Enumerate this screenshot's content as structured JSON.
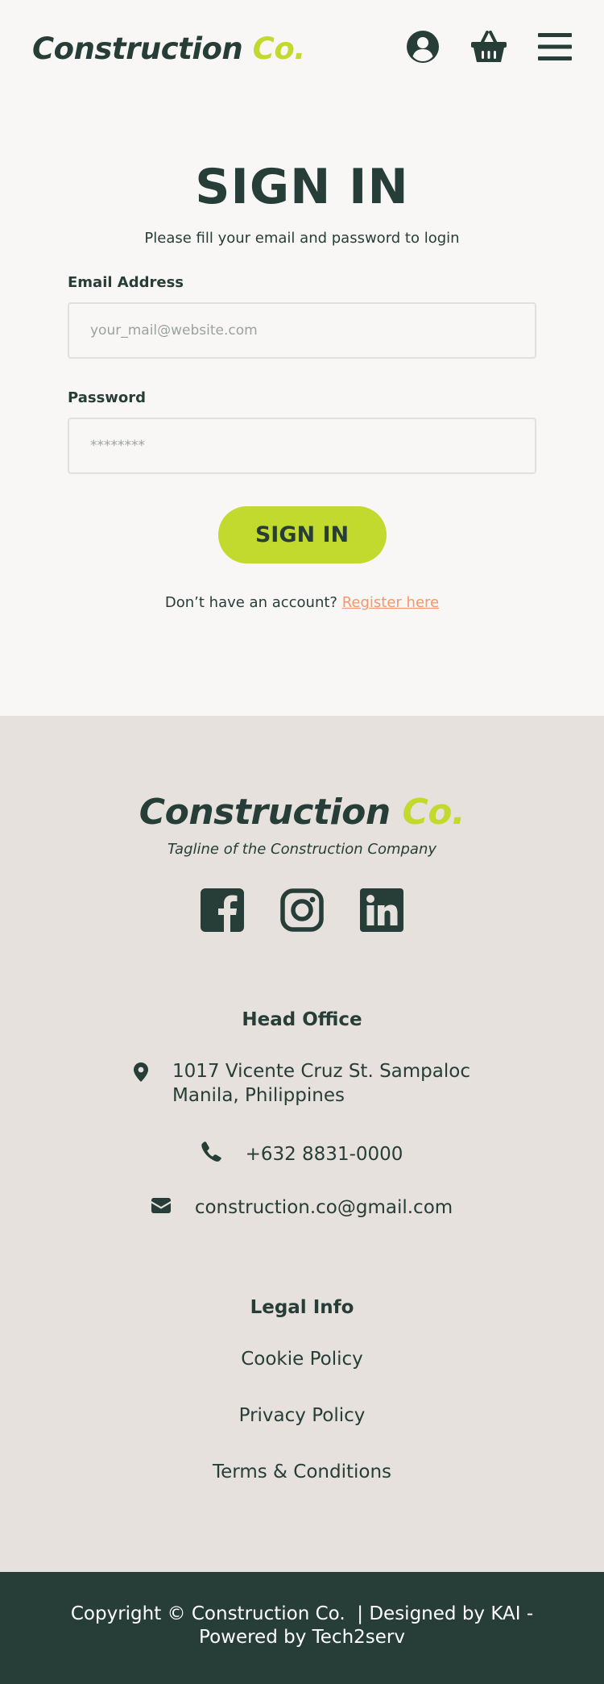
{
  "header": {
    "logo_main": "Construction",
    "logo_accent": "Co.",
    "icons": [
      "user-icon",
      "basket-icon",
      "menu-icon"
    ]
  },
  "signin": {
    "title": "SIGN IN",
    "subtitle": "Please fill your email and password to login",
    "email_label": "Email Address",
    "email_placeholder": "your_mail@website.com",
    "email_value": "",
    "password_label": "Password",
    "password_placeholder": "********",
    "password_value": "",
    "button_label": "SIGN IN",
    "register_prompt": "Don’t have an account?",
    "register_link": "Register here"
  },
  "footer": {
    "logo_main": "Construction",
    "logo_accent": "Co.",
    "tagline": "Tagline of the Construction Company",
    "social": [
      "facebook-icon",
      "instagram-icon",
      "linkedin-icon"
    ],
    "head_office": {
      "title": "Head Office",
      "address_line1": "1017 Vicente Cruz St. Sampaloc",
      "address_line2": "Manila, Philippines",
      "phone": "+632 8831-0000",
      "email": "construction.co@gmail.com"
    },
    "legal": {
      "title": "Legal Info",
      "links": [
        "Cookie Policy",
        "Privacy Policy",
        "Terms & Conditions"
      ]
    },
    "copyright_line1": "Copyright © Construction Co.  | Designed by KAI -",
    "copyright_line2": "Powered by Tech2serv"
  },
  "colors": {
    "primary": "#273d38",
    "accent": "#c2d92e",
    "link": "#f5956b",
    "background": "#f9f7f5",
    "footer_bg": "#e6e1dd"
  }
}
